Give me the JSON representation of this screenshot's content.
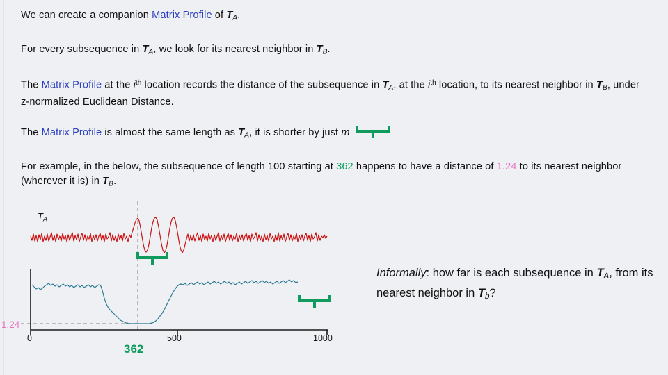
{
  "slide": {
    "background_color": "#eff0f4",
    "accent_blue": "#2b3fbf",
    "accent_green": "#0e9c5e",
    "accent_pink": "#e86fc0",
    "series_red": "#cc1111",
    "series_teal": "#2b7a94"
  },
  "paragraphs": {
    "p1": {
      "a": "We can create a companion ",
      "mp": "Matrix Profile",
      "b": " of ",
      "t": "T",
      "t_sub": "A",
      "c": "."
    },
    "p2": {
      "a": "For every subsequence in ",
      "t1": "T",
      "t1_sub": "A",
      "b": ", we look for its nearest neighbor in ",
      "t2": "T",
      "t2_sub": "B",
      "c": "."
    },
    "p3": {
      "a": "The ",
      "mp": "Matrix Profile",
      "b": " at the ",
      "i1": "i",
      "i1_sup": "th",
      "c": " location records the distance of the subsequence in ",
      "t1": "T",
      "t1_sub": "A",
      "d": ", at the ",
      "i2": "i",
      "i2_sup": "th",
      "e": " location, to its nearest neighbor in ",
      "t2": "T",
      "t2_sub": "B",
      "f": ", under z-normalized Euclidean Distance."
    },
    "p4": {
      "a": "The ",
      "mp": "Matrix Profile",
      "b": " is almost the same length as ",
      "t1": "T",
      "t1_sub": "A",
      "c": ", it is shorter by just ",
      "m": "m"
    },
    "p5": {
      "a": "For example, in the below, the subsequence of length 100 starting at ",
      "start": "362",
      "b": " happens to have a distance of ",
      "dist": "1.24",
      "c": " to its nearest neighbor (wherever it is) in ",
      "t2": "T",
      "t2_sub": "B",
      "d": "."
    }
  },
  "informal": {
    "lead": "Informally",
    "a": ": how far is each subsequence in ",
    "t1": "T",
    "t1_sub": "A",
    "b": ", from its nearest neighbor in ",
    "t2": "T",
    "t2_sub": "b",
    "c": "?"
  },
  "chart_data": {
    "type": "line",
    "title": "",
    "xlabel": "",
    "ylabel": "",
    "xlim": [
      0,
      1030
    ],
    "xticks": [
      0,
      500,
      1000
    ],
    "xtick_labels": [
      "0",
      "500",
      "1000"
    ],
    "grid": false,
    "legend": "none",
    "annotations": {
      "ta_label": "T",
      "ta_label_sub": "A",
      "highlight_x": "362",
      "highlight_x_value": 362,
      "distance_label": "1.24",
      "distance_value": 1.24,
      "subsequence_length": 100,
      "vertical_dashed_line_x": 362,
      "horizontal_dashed_line_y": 1.24
    },
    "series": [
      {
        "name": "T_A",
        "color": "#cc1111",
        "description": "noisy time series with three embedded sine cycles around x=362..500",
        "x_range": [
          0,
          1000
        ]
      },
      {
        "name": "Matrix Profile",
        "color": "#2b7a94",
        "description": "matrix profile, high plateau with a deep valley reaching 1.24 near x=362; ends at x=900 (shorter by m)",
        "x_range": [
          0,
          900
        ],
        "plateau_value": 6.2,
        "min_value": 1.24,
        "min_at_x": 362
      }
    ]
  }
}
